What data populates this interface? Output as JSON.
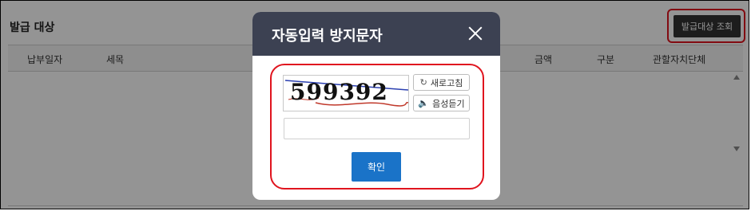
{
  "section": {
    "title": "발급 대상"
  },
  "toolbar": {
    "issue_button_label": "발급대상 조회"
  },
  "table": {
    "columns": [
      "납부일자",
      "세목",
      "금액",
      "구분",
      "관할자치단체"
    ]
  },
  "modal": {
    "title": "자동입력 방지문자",
    "captcha_text": "599392",
    "refresh_label": "새로고침",
    "audio_label": "음성듣기",
    "input_value": "",
    "confirm_label": "확인"
  },
  "colors": {
    "highlight": "#e0141e",
    "header": "#3c4152",
    "primary": "#1a73c8"
  }
}
